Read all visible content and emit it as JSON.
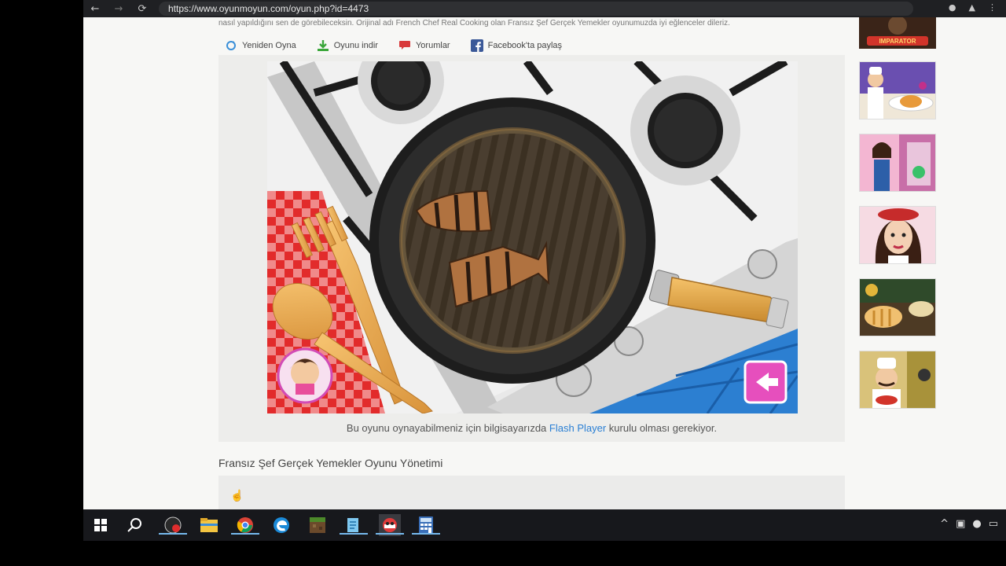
{
  "browser": {
    "url": "https://www.oyunmoyun.com/oyun.php?id=4473"
  },
  "page": {
    "intro_text": "nasıl yapıldığını sen de görebileceksin. Orijinal adı French Chef Real Cooking olan Fransız Şef Gerçek Yemekler oyunumuzda iyi eğlenceler dileriz.",
    "actions": [
      {
        "label": "Yeniden Oyna",
        "icon": "replay-icon"
      },
      {
        "label": "Oyunu indir",
        "icon": "download-icon"
      },
      {
        "label": "Yorumlar",
        "icon": "comments-icon"
      },
      {
        "label": "Facebook'ta paylaş",
        "icon": "facebook-icon"
      }
    ],
    "flash_note_before": "Bu oyunu oynayabilmeniz için bilgisayarızda",
    "flash_link": "Flash Player",
    "flash_note_after": "kurulu olması gerekiyor.",
    "controls_title": "Fransız Şef Gerçek Yemekler Oyunu Yönetimi"
  },
  "sidebar": {
    "thumbnails": [
      {
        "name": "imparator-game",
        "caption": "IMPARATOR"
      },
      {
        "name": "chef-girl-game",
        "caption": ""
      },
      {
        "name": "fashion-game",
        "caption": ""
      },
      {
        "name": "makeup-girl-game",
        "caption": ""
      },
      {
        "name": "kitchen-game",
        "caption": ""
      },
      {
        "name": "chef-man-game",
        "caption": ""
      }
    ]
  },
  "taskbar": {
    "apps": [
      "start",
      "search",
      "app-red",
      "file-explorer",
      "chrome",
      "edge",
      "minecraft",
      "notepad",
      "game-app",
      "calculator"
    ]
  },
  "colors": {
    "link": "#2a7fd4",
    "taskbar": "#17181c",
    "game_back_button": "#e64fbd"
  }
}
